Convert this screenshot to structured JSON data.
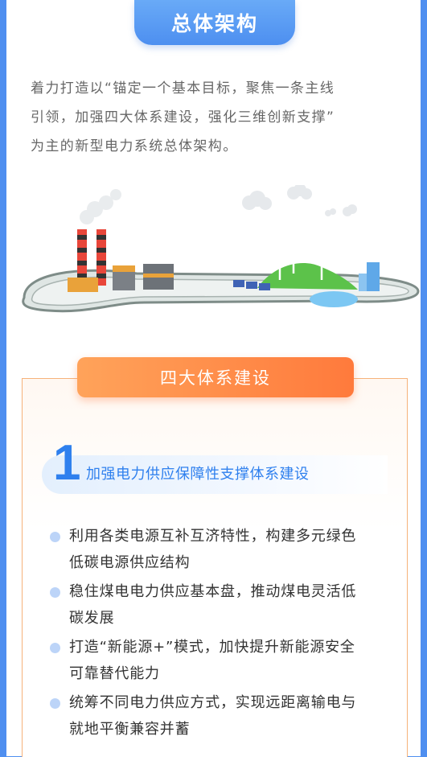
{
  "header": {
    "title": "总体架构"
  },
  "intro": {
    "lines": [
      "着力打造以“锚定一个基本目标，聚焦一条主线",
      "引领，加强四大体系建设，强化三维创新支撑”",
      "为主的新型电力系统总体架构。"
    ]
  },
  "section": {
    "title": "四大体系建设",
    "subsection": {
      "number": "1",
      "title": "加强电力供应保障性支撑体系建设"
    },
    "bullets": [
      {
        "lines": [
          "利用各类电源互补互济特性，构建多元绿色",
          "低碳电源供应结构"
        ]
      },
      {
        "lines": [
          "稳住煤电电力供应基本盘，推动煤电灵活低",
          "碳发展"
        ]
      },
      {
        "lines": [
          "打造“新能源+”模式，加快提升新能源安全",
          "可靠替代能力"
        ]
      },
      {
        "lines": [
          "统筹不同电力供应方式，实现远距离输电与",
          "就地平衡兼容并蓄"
        ]
      }
    ]
  },
  "colors": {
    "accent_blue": "#4f8ff0",
    "accent_orange": "#ff8a46",
    "text_dark": "#333333"
  }
}
